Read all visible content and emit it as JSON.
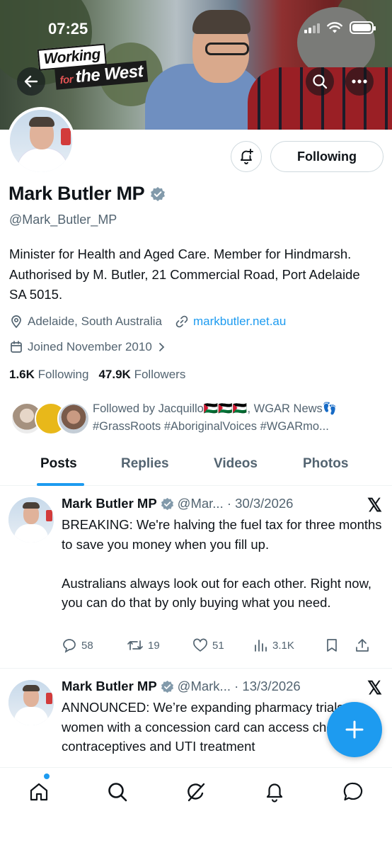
{
  "status_bar": {
    "time": "07:25"
  },
  "banner": {
    "sticker_line1": "Working",
    "sticker_for": "for",
    "sticker_line2": "the West"
  },
  "profile": {
    "name": "Mark Butler MP",
    "handle": "@Mark_Butler_MP",
    "following_button": "Following",
    "bio": "Minister for Health and Aged Care. Member for Hindmarsh. Authorised by M. Butler, 21 Commercial Road, Port Adelaide SA 5015.",
    "location": "Adelaide, South Australia",
    "website": "markbutler.net.au",
    "joined": "Joined November 2010",
    "following_count": "1.6K",
    "following_label": "Following",
    "followers_count": "47.9K",
    "followers_label": "Followers",
    "followed_by": "Followed by Jacquillo🇵🇸🇵🇸🇵🇸, WGAR News👣 #GrassRoots #AboriginalVoices #WGARmo..."
  },
  "tabs": [
    {
      "label": "Posts",
      "active": true
    },
    {
      "label": "Replies",
      "active": false
    },
    {
      "label": "Videos",
      "active": false
    },
    {
      "label": "Photos",
      "active": false
    }
  ],
  "posts": [
    {
      "name": "Mark Butler MP",
      "meta": "@Mar... · 30/3/2026",
      "text": "BREAKING: We're halving the fuel tax for three months to save you money when you fill up.\n\nAustralians always look out for each other. Right now, you can do that by only buying what you need.",
      "replies": "58",
      "reposts": "19",
      "likes": "51",
      "views": "3.1K"
    },
    {
      "name": "Mark Butler MP",
      "meta": "@Mark... · 13/3/2026",
      "text": "ANNOUNCED: We’re expanding pharmacy trials so women with a concession card can access cheaper contraceptives and UTI treatment",
      "replies": "",
      "reposts": "",
      "likes": "",
      "views": ""
    }
  ],
  "colors": {
    "accent": "#1d9bf0",
    "verified": "#829aab",
    "text": "#0f1419",
    "muted": "#536471"
  }
}
